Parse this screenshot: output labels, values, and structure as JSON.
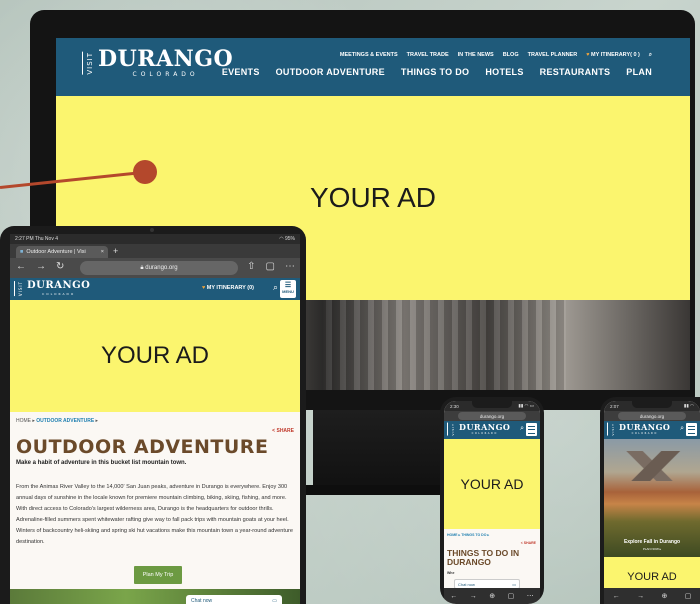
{
  "brand": {
    "visit": "VISIT",
    "name": "DURANGO",
    "sub": "COLORADO"
  },
  "monitor": {
    "top_links": [
      "MEETINGS & EVENTS",
      "TRAVEL TRADE",
      "IN THE NEWS",
      "BLOG",
      "TRAVEL PLANNER",
      "MY ITINERARY( 0 )"
    ],
    "main_links": [
      "EVENTS",
      "OUTDOOR ADVENTURE",
      "THINGS TO DO",
      "HOTELS",
      "RESTAURANTS",
      "PLAN"
    ],
    "ad_text": "YOUR AD"
  },
  "tablet": {
    "status_time": "2:27 PM  Thu Nov 4",
    "status_batt": "95%",
    "tab_title": "Outdoor Adventure | Visi",
    "url": "durango.org",
    "itinerary": "MY ITINERARY (0)",
    "menu_label": "MENU",
    "ad_text": "YOUR AD",
    "breadcrumb_home": "HOME",
    "breadcrumb_current": "OUTDOOR ADVENTURE",
    "share": "SHARE",
    "heading": "OUTDOOR ADVENTURE",
    "subheading": "Make a habit of adventure in this bucket list mountain town.",
    "paragraph": "From the Animas River Valley to the 14,000' San Juan peaks, adventure in Durango is everywhere. Enjoy 300 annual days of sunshine in the locale known for premiere mountain climbing, biking, skiing, fishing, and more. With direct access to Colorado's largest wilderness area, Durango is the headquarters for outdoor thrills. Adrenaline-filled summers spent whitewater rafting give way to fall pack trips with mountain goats at your heel. Winters of backcountry heli-skiing and spring ski hut vacations make this mountain town a year-round adventure destination.",
    "button": "Plan My Trip",
    "chat": "Chat now"
  },
  "phone1": {
    "time": "2:30",
    "url": "durango.org",
    "ad_text": "YOUR AD",
    "breadcrumb": "HOME ▸ THINGS TO DO ▸",
    "share": "SHARE",
    "heading": "THINGS TO DO IN DURANGO",
    "sub": "Whe",
    "chat": "Chat now"
  },
  "phone2": {
    "time": "2:07",
    "url": "durango.org",
    "hero_title": "Explore Fall in Durango",
    "hero_cta": "PLAN NOW ▸",
    "ad_text": "YOUR AD"
  },
  "colors": {
    "brand_blue": "#1f5a7a",
    "ad_yellow": "#fbf56e",
    "callout": "#b4482c",
    "heading_brown": "#6b4a2a",
    "button_green": "#6c9a42"
  }
}
